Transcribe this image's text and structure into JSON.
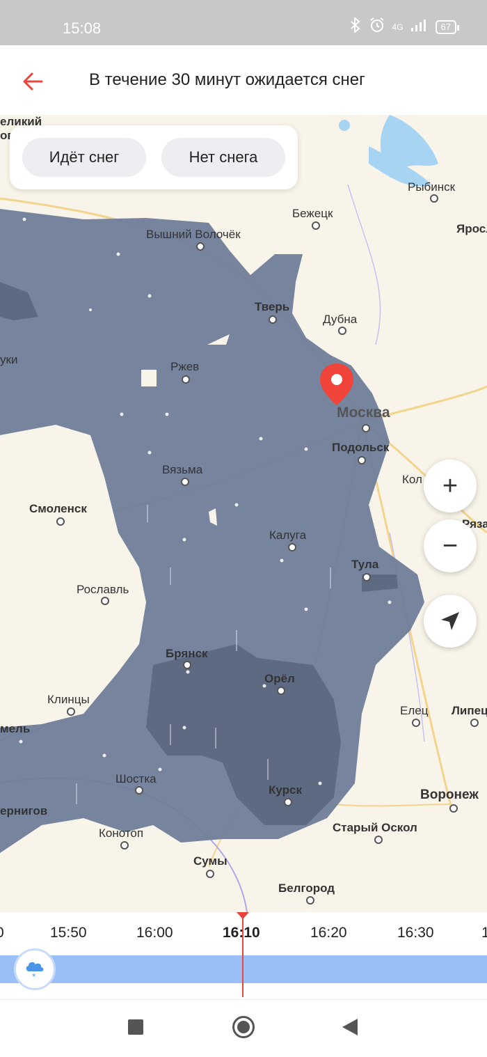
{
  "status": {
    "time": "15:08",
    "network": "4G",
    "battery": "67"
  },
  "header": {
    "title": "В течение 30 минут ожидается снег"
  },
  "filters": {
    "snow_label": "Идёт снег",
    "nosnow_label": "Нет снега"
  },
  "map": {
    "cities": {
      "velikiy": "еликий",
      "velikiy2": "ов",
      "rybinsk": "Рыбинск",
      "yaros": "Яросл",
      "bezhetsk": "Бежецк",
      "vyshniy": "Вышний Волочёк",
      "tver": "Тверь",
      "dubna": "Дубна",
      "ruki": "уки",
      "rzhev": "Ржев",
      "moskva": "Москва",
      "podolsk": "Подольск",
      "kol": "Кол",
      "vyazma": "Вязьма",
      "smolensk": "Смоленск",
      "ryaz": "Ряза",
      "kaluga": "Калуга",
      "tula": "Тула",
      "roslavl": "Рославль",
      "bryansk": "Брянск",
      "orel": "Орёл",
      "klintsy": "Клинцы",
      "elets": "Елец",
      "lipetsk": "Липец",
      "gomel": "мель",
      "shostka": "Шостка",
      "kursk": "Курск",
      "voronezh": "Воронеж",
      "chernigov": "ернигов",
      "konotop": "Конотоп",
      "staryoskol": "Старый Оскол",
      "sumy": "Сумы",
      "belgorod": "Белгород"
    }
  },
  "controls": {
    "zoom_in": "+",
    "zoom_out": "−"
  },
  "timeline": {
    "ticks": [
      "0",
      "15:50",
      "16:00",
      "16:10",
      "16:20",
      "16:30",
      "1"
    ],
    "current": "16:10"
  },
  "colors": {
    "precip": "#6f7d99",
    "precip_dark": "#5c6680",
    "accent": "#e8453c",
    "timeline_bar": "#99bff6"
  }
}
